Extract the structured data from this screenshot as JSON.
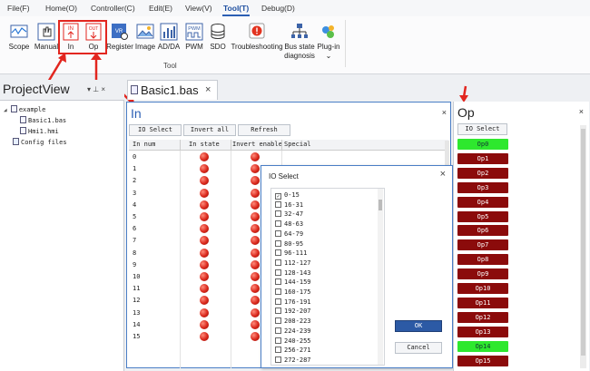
{
  "menu": [
    "File(F)",
    "Home(O)",
    "Controller(C)",
    "Edit(E)",
    "View(V)",
    "Tool(T)",
    "Debug(D)"
  ],
  "ribbon": {
    "items": [
      {
        "key": "scope",
        "label": "Scope"
      },
      {
        "key": "manual",
        "label": "Manual"
      },
      {
        "key": "in",
        "label": "In",
        "icon_text": "IN"
      },
      {
        "key": "op",
        "label": "Op",
        "icon_text": "OUT"
      },
      {
        "key": "register",
        "label": "Register"
      },
      {
        "key": "image",
        "label": "Image"
      },
      {
        "key": "adda",
        "label": "AD/DA"
      },
      {
        "key": "pwm",
        "label": "PWM",
        "icon_text": "PWM"
      },
      {
        "key": "sdo",
        "label": "SDO"
      },
      {
        "key": "troubleshooting",
        "label": "Troubleshooting"
      },
      {
        "key": "bus",
        "label": "Bus state diagnosis",
        "label2": "diagnosis",
        "label1": "Bus state"
      },
      {
        "key": "plugin",
        "label": "Plug-in"
      }
    ],
    "group_label": "Tool",
    "accent": "#e2261f"
  },
  "project_view": {
    "title": "ProjectView",
    "controls": "▾ ⊥ ×",
    "tree": [
      "example",
      "Basic1.bas",
      "Hmi1.hmi",
      "Config files"
    ]
  },
  "doc_tab": {
    "label": "Basic1.bas",
    "close": "×"
  },
  "in_panel": {
    "title": "In",
    "close": "×",
    "buttons": [
      "IO Select",
      "Invert all",
      "Refresh"
    ],
    "columns": [
      "In num",
      "In state",
      "Invert enable",
      "Special"
    ],
    "rows": [
      "0",
      "1",
      "2",
      "3",
      "4",
      "5",
      "6",
      "7",
      "8",
      "9",
      "10",
      "11",
      "12",
      "13",
      "14",
      "15"
    ]
  },
  "dialog": {
    "title": "IO Select",
    "close": "×",
    "ranges": [
      {
        "label": "0-15",
        "checked": true
      },
      {
        "label": "16-31",
        "checked": false
      },
      {
        "label": "32-47",
        "checked": false
      },
      {
        "label": "48-63",
        "checked": false
      },
      {
        "label": "64-79",
        "checked": false
      },
      {
        "label": "80-95",
        "checked": false
      },
      {
        "label": "96-111",
        "checked": false
      },
      {
        "label": "112-127",
        "checked": false
      },
      {
        "label": "128-143",
        "checked": false
      },
      {
        "label": "144-159",
        "checked": false
      },
      {
        "label": "160-175",
        "checked": false
      },
      {
        "label": "176-191",
        "checked": false
      },
      {
        "label": "192-207",
        "checked": false
      },
      {
        "label": "208-223",
        "checked": false
      },
      {
        "label": "224-239",
        "checked": false
      },
      {
        "label": "240-255",
        "checked": false
      },
      {
        "label": "256-271",
        "checked": false
      },
      {
        "label": "272-287",
        "checked": false
      }
    ],
    "ok": "OK",
    "cancel": "Cancel"
  },
  "op_panel": {
    "title": "Op",
    "close": "×",
    "io_select": "IO Select",
    "outputs": [
      {
        "label": "Op0",
        "on": true
      },
      {
        "label": "Op1",
        "on": false
      },
      {
        "label": "Op2",
        "on": false
      },
      {
        "label": "Op3",
        "on": false
      },
      {
        "label": "Op4",
        "on": false
      },
      {
        "label": "Op5",
        "on": false
      },
      {
        "label": "Op6",
        "on": false
      },
      {
        "label": "Op7",
        "on": false
      },
      {
        "label": "Op8",
        "on": false
      },
      {
        "label": "Op9",
        "on": false
      },
      {
        "label": "Op10",
        "on": false
      },
      {
        "label": "Op11",
        "on": false
      },
      {
        "label": "Op12",
        "on": false
      },
      {
        "label": "Op13",
        "on": false
      },
      {
        "label": "Op14",
        "on": true
      },
      {
        "label": "Op15",
        "on": false
      }
    ]
  },
  "colors": {
    "led_off": "#d8261a",
    "op_off": "#8b0b0b",
    "op_on": "#2ee82e",
    "dialog_ok": "#2c5aa5",
    "panel_border": "#4a7ec6"
  }
}
